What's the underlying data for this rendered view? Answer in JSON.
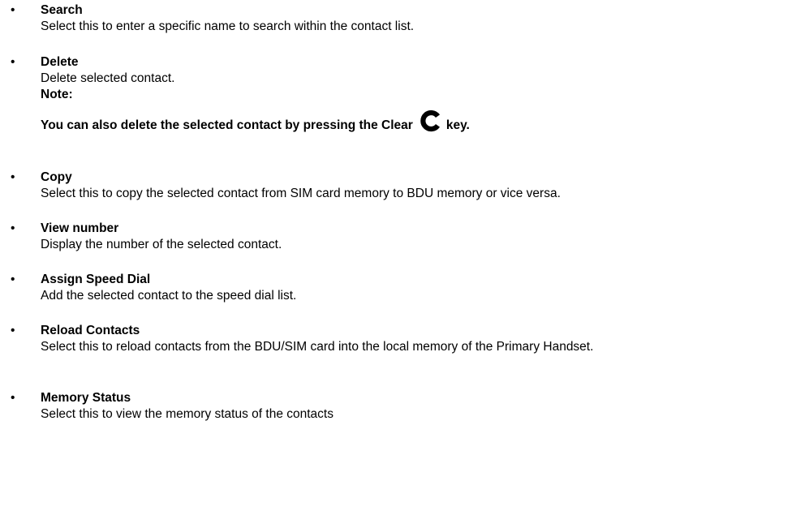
{
  "items": [
    {
      "term": "Search",
      "description": "Select this to enter a specific name to search within the contact list."
    },
    {
      "term": "Delete",
      "description": "Delete selected contact.",
      "note_label": "Note:",
      "note_text_before": "You can also delete the selected contact by pressing the Clear",
      "note_text_after": "key.",
      "note_icon": "clear-c-key-icon"
    },
    {
      "term": "Copy",
      "description": "Select this to copy the selected contact from SIM card memory to BDU memory or vice versa."
    },
    {
      "term": "View number",
      "description": "Display the number of the selected contact."
    },
    {
      "term": "Assign Speed Dial",
      "description": "Add the selected contact to the speed dial list."
    },
    {
      "term": "Reload Contacts",
      "description": "Select this to reload contacts from the BDU/SIM card into the local memory of the Primary Handset."
    },
    {
      "term": "Memory Status",
      "description": "Select this to view the memory status of the contacts"
    }
  ],
  "bullet_glyph": "•"
}
